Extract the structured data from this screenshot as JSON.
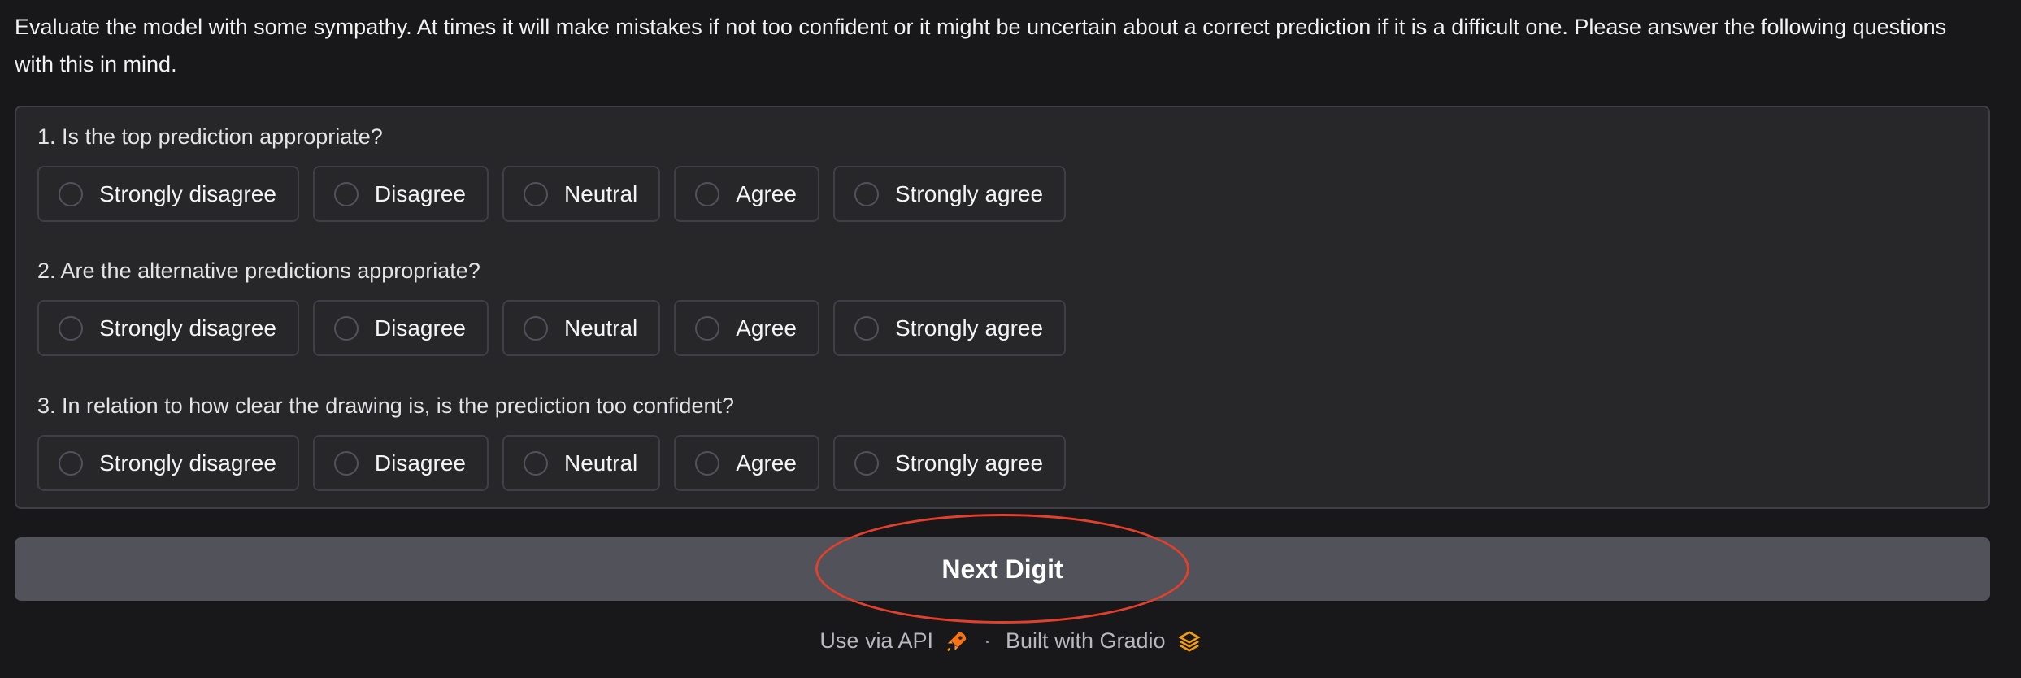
{
  "intro_text": "Evaluate the model with some sympathy. At times it will make mistakes if not too confident or it might be uncertain about a correct prediction if it is a difficult one. Please answer the following questions with this in mind.",
  "questions": [
    {
      "label": "1. Is the top prediction appropriate?",
      "options": [
        "Strongly disagree",
        "Disagree",
        "Neutral",
        "Agree",
        "Strongly agree"
      ]
    },
    {
      "label": "2. Are the alternative predictions appropriate?",
      "options": [
        "Strongly disagree",
        "Disagree",
        "Neutral",
        "Agree",
        "Strongly agree"
      ]
    },
    {
      "label": "3. In relation to how clear the drawing is, is the prediction too confident?",
      "options": [
        "Strongly disagree",
        "Disagree",
        "Neutral",
        "Agree",
        "Strongly agree"
      ]
    }
  ],
  "next_button": {
    "label": "Next Digit"
  },
  "footer": {
    "api_label": "Use via API",
    "separator": "·",
    "built_with": "Built with Gradio",
    "api_icon": "rocket-icon",
    "gradio_icon": "gradio-logo-icon"
  },
  "colors": {
    "background": "#18181b",
    "panel": "#27272a",
    "button": "#52525b",
    "highlight": "#e2402d",
    "gradio_orange": "#f59e0b"
  }
}
